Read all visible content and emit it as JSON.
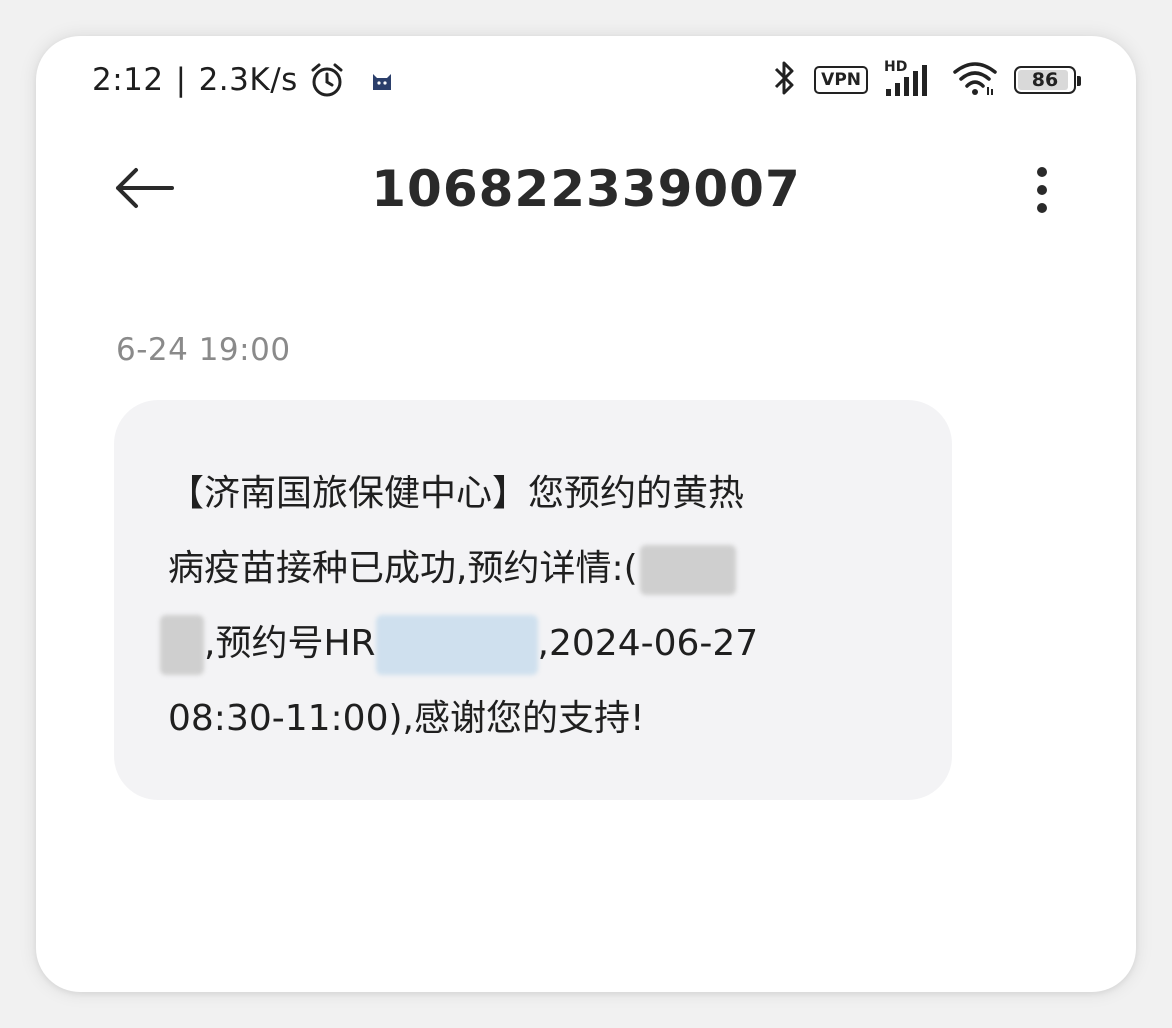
{
  "status_bar": {
    "time": "2:12",
    "separator": "|",
    "network_speed": "2.3K/s",
    "left_icons": [
      "alarm-icon",
      "app-notification-icon"
    ],
    "right_icons": [
      "bluetooth-icon",
      "vpn-icon",
      "hd-signal-icon",
      "wifi-icon",
      "battery-icon"
    ],
    "vpn_label": "VPN",
    "hd_label": "HD",
    "battery_level": "86"
  },
  "header": {
    "title": "106822339007",
    "back_icon": "arrow-left-icon",
    "more_icon": "more-vertical-icon"
  },
  "messages": [
    {
      "timestamp": "6-24 19:00",
      "line1": "【济南国旅保健中心】您预约的黄热",
      "line2_a": "病疫苗接种已成功,预约详情:(",
      "line3_a": ",预约号HR",
      "line3_b": ",2024-06-27",
      "line4": "08:30-11:00),感谢您的支持!"
    }
  ]
}
